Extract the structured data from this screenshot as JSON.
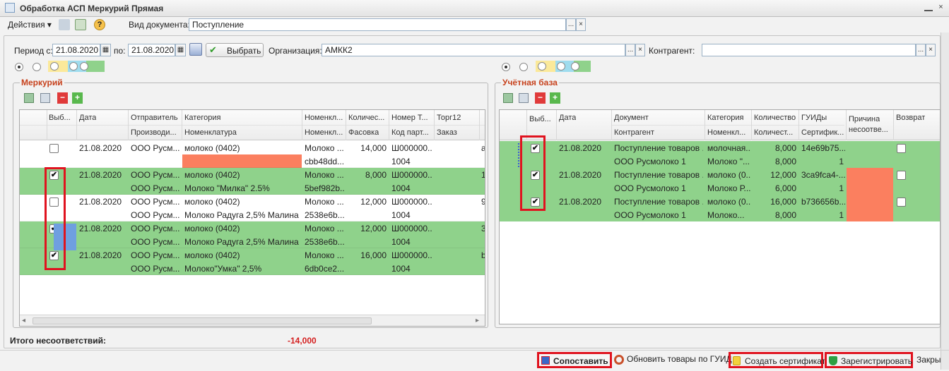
{
  "window": {
    "title": "Обработка  АСП Меркурий Прямая",
    "close_glyph": "×"
  },
  "toolbar": {
    "actions_label": "Действия ▾",
    "doc_type_label": "Вид документа:",
    "doc_type_value": "Поступление"
  },
  "filter": {
    "period_from_label": "Период с:",
    "period_from": "21.08.2020",
    "period_to_label": "по:",
    "period_to": "21.08.2020",
    "select_label": "Выбрать",
    "org_label": "Организация:",
    "org_value": "АМКК2",
    "contractor_label": "Контрагент:",
    "contractor_value": ""
  },
  "icons": {
    "dots": "...",
    "x": "×",
    "plus": "+",
    "minus": "−",
    "check": "✔",
    "cal": "▦",
    "help": "?",
    "arrow_left": "◂",
    "arrow_right": "▸"
  },
  "mercury": {
    "title": "Меркурий",
    "headers1": [
      "Выб...",
      "Дата",
      "Отправитель",
      "Категория",
      "Номенкл...",
      "Количес...",
      "Номер Т...",
      "Торг12"
    ],
    "headers2": [
      "Производи...",
      "Номенклатура",
      "Номенкл...",
      "Фасовка",
      "Код парт...",
      "Заказ"
    ],
    "rows": [
      {
        "checked": false,
        "date": "21.08.2020",
        "sender": "ООО Русм...",
        "category": "молоко (0402)",
        "nom": "Молоко ...",
        "qty": "14,000",
        "num": "Ш000000...",
        "producer": "",
        "nomenclature": "",
        "nom2": "cbb48dd...",
        "pack": "",
        "code": "1004",
        "green": false,
        "tail": "а"
      },
      {
        "checked": true,
        "date": "21.08.2020",
        "sender": "ООО Русм...",
        "category": "молоко (0402)",
        "nom": "Молоко ...",
        "qty": "8,000",
        "num": "Ш000000...",
        "producer": "ООО Русм...",
        "nomenclature": "Молоко \"Милка\" 2.5%",
        "nom2": "5bef982b...",
        "pack": "",
        "code": "1004",
        "green": true,
        "tail": "1"
      },
      {
        "checked": false,
        "date": "21.08.2020",
        "sender": "ООО Русм...",
        "category": "молоко (0402)",
        "nom": "Молоко ...",
        "qty": "12,000",
        "num": "Ш000000...",
        "producer": "ООО Русм...",
        "nomenclature": "Молоко Радуга 2,5% Малина",
        "nom2": "2538e6b...",
        "pack": "",
        "code": "1004",
        "green": false,
        "tail": "9"
      },
      {
        "checked": true,
        "date": "21.08.2020",
        "sender": "ООО Русм...",
        "category": "молоко (0402)",
        "nom": "Молоко ...",
        "qty": "12,000",
        "num": "Ш000000...",
        "producer": "ООО Русм...",
        "nomenclature": "Молоко Радуга 2,5% Малина",
        "nom2": "2538e6b...",
        "pack": "",
        "code": "1004",
        "green": true,
        "tail": "3"
      },
      {
        "checked": true,
        "date": "21.08.2020",
        "sender": "ООО Русм...",
        "category": "молоко (0402)",
        "nom": "Молоко ...",
        "qty": "16,000",
        "num": "Ш000000...",
        "producer": "ООО Русм...",
        "nomenclature": "Молоко\"Умка\" 2,5%",
        "nom2": "6db0ce2...",
        "pack": "",
        "code": "1004",
        "green": true,
        "tail": "b"
      }
    ]
  },
  "base": {
    "title": "Учётная база",
    "headers1": [
      "Выб...",
      "Дата",
      "Документ",
      "Категория",
      "Количество",
      "ГУИДы",
      "Причина",
      "Возврат"
    ],
    "headers2": [
      "Контрагент",
      "Номенкл...",
      "Количест...",
      "Сертифик...",
      "несоотве..."
    ],
    "rows": [
      {
        "checked": true,
        "date": "21.08.2020",
        "doc": "Поступление товаров ...",
        "category": "молочная...",
        "qty": "8,000",
        "guid": "14e69b75...",
        "contractor": "ООО Русмолоко 1",
        "nom": "Молоко \"...",
        "qty2": "8,000",
        "cert": "1",
        "red": false
      },
      {
        "checked": true,
        "date": "21.08.2020",
        "doc": "Поступление товаров ...",
        "category": "молоко (0...",
        "qty": "12,000",
        "guid": "3ca9fca4-...",
        "contractor": "ООО Русмолоко 1",
        "nom": "Молоко Р...",
        "qty2": "6,000",
        "cert": "1",
        "red": true
      },
      {
        "checked": true,
        "date": "21.08.2020",
        "doc": "Поступление товаров ...",
        "category": "молоко (0...",
        "qty": "16,000",
        "guid": "b736656b...",
        "contractor": "ООО Русмолоко 1",
        "nom": "Молоко...",
        "qty2": "8,000",
        "cert": "1",
        "red": true
      }
    ]
  },
  "summary": {
    "label": "Итого несоответствий:",
    "value": "-14,000"
  },
  "buttons": {
    "compare": "Сопоставить",
    "update": "Обновить товары по ГУИД",
    "create_cert": "Создать сертификат",
    "register": "Зарегистрировать",
    "close": "Закрыть"
  },
  "colors": {
    "green": "#8fd28b",
    "salmon": "#fb7f5f",
    "red_frame": "#e0131f",
    "title": "#c7421d"
  }
}
